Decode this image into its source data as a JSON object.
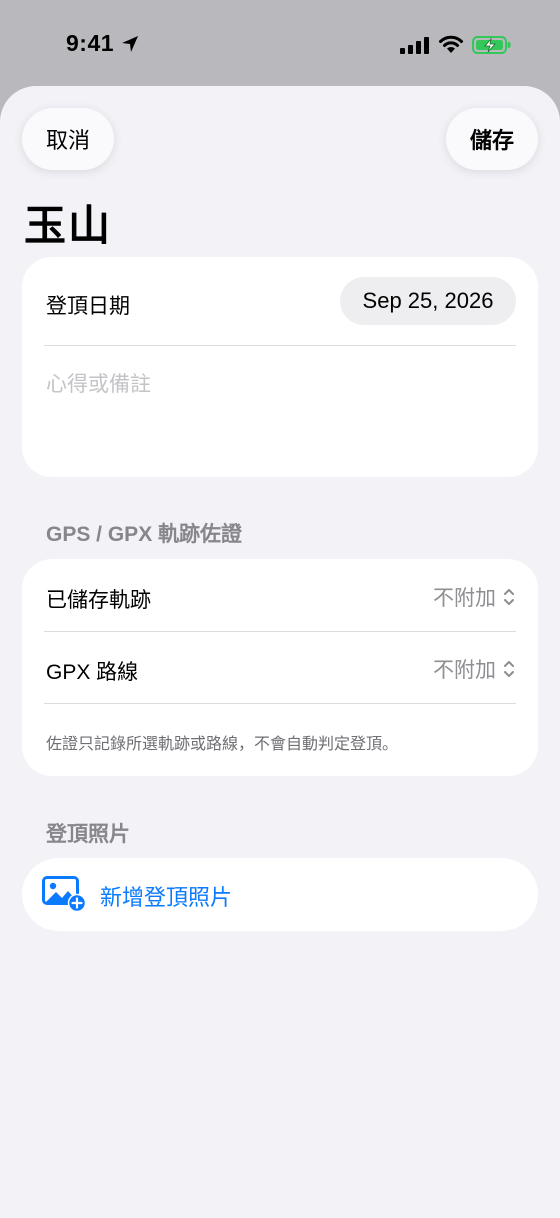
{
  "status_bar": {
    "time": "9:41"
  },
  "toolbar": {
    "cancel_label": "取消",
    "save_label": "儲存"
  },
  "title": "玉山",
  "summit_card": {
    "date_label": "登頂日期",
    "date_value": "Sep 25, 2026",
    "notes_placeholder": "心得或備註"
  },
  "gps_section": {
    "header": "GPS / GPX 軌跡佐證",
    "rows": [
      {
        "label": "已儲存軌跡",
        "value": "不附加"
      },
      {
        "label": "GPX 路線",
        "value": "不附加"
      }
    ],
    "footnote": "佐證只記錄所選軌跡或路線，不會自動判定登頂。"
  },
  "photo_section": {
    "header": "登頂照片",
    "add_label": "新增登頂照片",
    "icon": "photo-add-icon"
  },
  "colors": {
    "accent": "#0a7aff",
    "sheet_background": "#f2f2f7",
    "secondary_text": "#8e8e93",
    "battery_green": "#34c759"
  }
}
